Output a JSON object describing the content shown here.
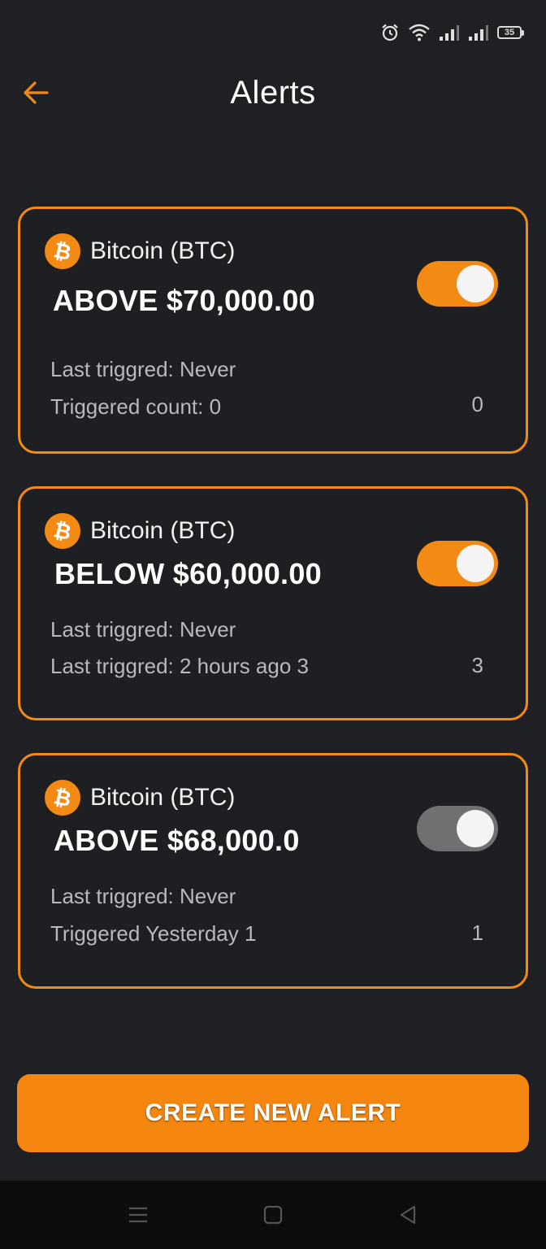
{
  "status_bar": {
    "battery": "35",
    "icons": [
      "alarm-icon",
      "wifi-icon",
      "signal-icon",
      "signal-icon",
      "battery-icon"
    ]
  },
  "header": {
    "title": "Alerts",
    "back_icon": "arrow-left-icon"
  },
  "colors": {
    "accent": "#f28a14",
    "background": "#1f2023",
    "toggle_off": "#6f7072"
  },
  "alerts": [
    {
      "coin": "Bitcoin (BTC)",
      "coin_symbol": "₿",
      "condition": "ABOVE $70,000.00",
      "line1": "Last triggred: Never",
      "line2": "Triggered count: 0",
      "count": "0",
      "enabled": true
    },
    {
      "coin": "Bitcoin (BTC)",
      "coin_symbol": "₿",
      "condition": "BELOW $60,000.00",
      "line1": "Last triggred: Never",
      "line2": "Last triggred: 2 hours ago 3",
      "count": "3",
      "enabled": true
    },
    {
      "coin": "Bitcoin (BTC)",
      "coin_symbol": "₿",
      "condition": "ABOVE $68,000.0",
      "line1": "Last triggred: Never",
      "line2": "Triggered Yesterday 1",
      "count": "1",
      "enabled": false
    }
  ],
  "create_button": {
    "label": "CREATE NEW ALERT"
  },
  "nav": {
    "icons": [
      "menu-icon",
      "home-square-icon",
      "back-triangle-icon"
    ]
  }
}
